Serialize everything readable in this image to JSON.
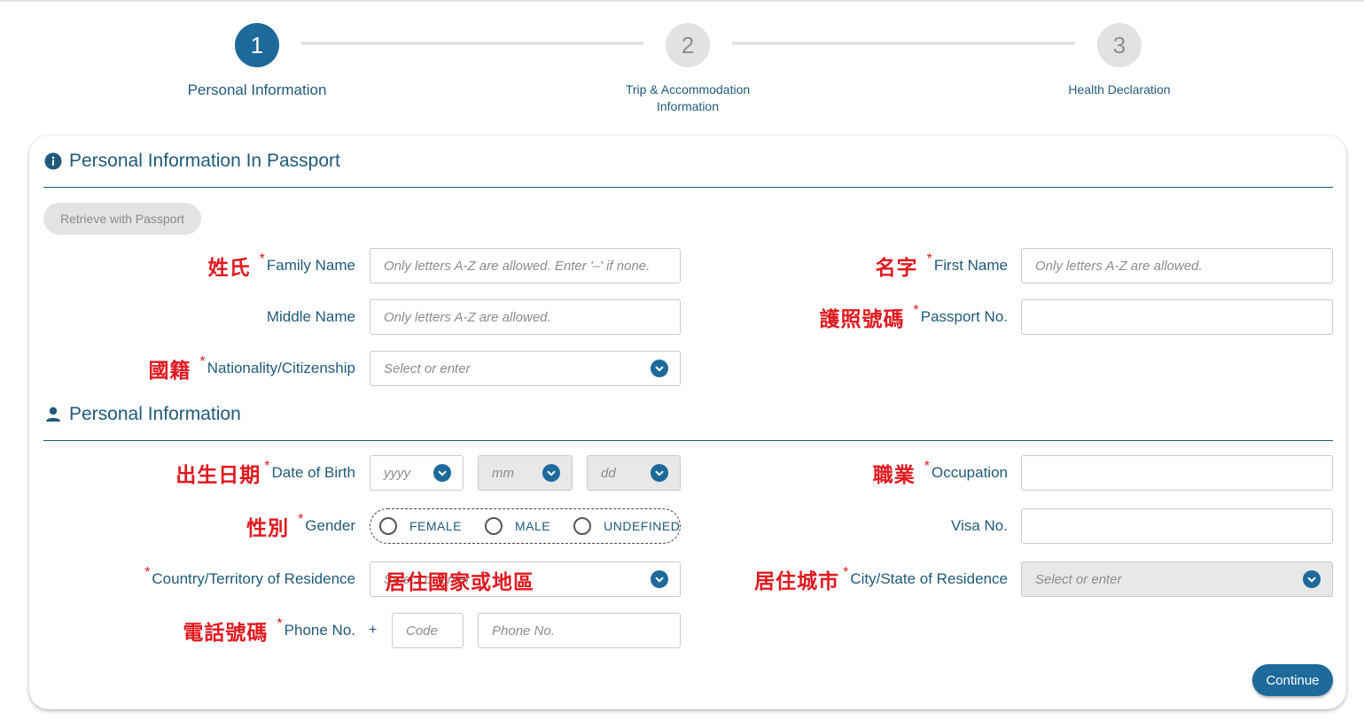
{
  "stepper": {
    "steps": [
      {
        "number": "1",
        "label": "Personal Information"
      },
      {
        "number": "2",
        "label_line1": "Trip & Accommodation",
        "label_line2": "Information"
      },
      {
        "number": "3",
        "label": "Health Declaration"
      }
    ]
  },
  "passport_section": {
    "title": "Personal Information In Passport",
    "icon": "info-icon",
    "retrieve_button": "Retrieve with Passport",
    "family_name": {
      "cn": "姓氏",
      "star": "*",
      "label": "Family Name",
      "placeholder": "Only letters A-Z are allowed. Enter '–' if none."
    },
    "first_name": {
      "cn": "名字",
      "star": "*",
      "label": "First Name",
      "placeholder": "Only letters A-Z are allowed."
    },
    "middle_name": {
      "label": "Middle Name",
      "placeholder": "Only letters A-Z are allowed."
    },
    "passport_no": {
      "cn": "護照號碼",
      "star": "*",
      "label": "Passport No.",
      "value": ""
    },
    "nationality": {
      "cn": "國籍",
      "star": "*",
      "label": "Nationality/Citizenship",
      "placeholder": "Select or enter"
    }
  },
  "personal_section": {
    "title": "Personal Information",
    "icon": "person-icon",
    "dob": {
      "cn": "出生日期",
      "star": "*",
      "label": "Date of Birth",
      "yyyy": "yyyy",
      "mm": "mm",
      "dd": "dd"
    },
    "occupation": {
      "cn": "職業",
      "star": "*",
      "label": "Occupation",
      "value": ""
    },
    "gender": {
      "cn": "性別",
      "star": "*",
      "label": "Gender",
      "options": [
        "FEMALE",
        "MALE",
        "UNDEFINED"
      ]
    },
    "visa_no": {
      "label": "Visa No.",
      "value": ""
    },
    "country": {
      "star": "*",
      "label": "Country/Territory of Residence",
      "placeholder": "Select or enter",
      "overlay_cn": "居住國家或地區"
    },
    "city": {
      "cn": "居住城市",
      "star": "*",
      "label": "City/State of Residence",
      "placeholder": "Select or enter"
    },
    "phone": {
      "cn": "電話號碼",
      "star": "*",
      "label": "Phone No.",
      "plus": "+",
      "code_placeholder": "Code",
      "number_placeholder": "Phone No."
    }
  },
  "continue_button": "Continue",
  "colors": {
    "primary": "#1d6a9b",
    "text": "#1f5a7a",
    "annotation_red": "#e0191f",
    "inactive": "#e2e2e2"
  }
}
